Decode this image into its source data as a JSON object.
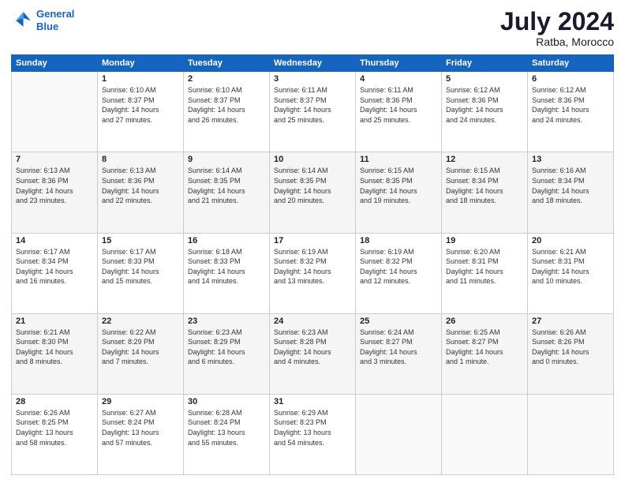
{
  "header": {
    "logo_line1": "General",
    "logo_line2": "Blue",
    "main_title": "July 2024",
    "subtitle": "Ratba, Morocco"
  },
  "days_of_week": [
    "Sunday",
    "Monday",
    "Tuesday",
    "Wednesday",
    "Thursday",
    "Friday",
    "Saturday"
  ],
  "weeks": [
    [
      {
        "day": "",
        "info": ""
      },
      {
        "day": "1",
        "info": "Sunrise: 6:10 AM\nSunset: 8:37 PM\nDaylight: 14 hours\nand 27 minutes."
      },
      {
        "day": "2",
        "info": "Sunrise: 6:10 AM\nSunset: 8:37 PM\nDaylight: 14 hours\nand 26 minutes."
      },
      {
        "day": "3",
        "info": "Sunrise: 6:11 AM\nSunset: 8:37 PM\nDaylight: 14 hours\nand 25 minutes."
      },
      {
        "day": "4",
        "info": "Sunrise: 6:11 AM\nSunset: 8:36 PM\nDaylight: 14 hours\nand 25 minutes."
      },
      {
        "day": "5",
        "info": "Sunrise: 6:12 AM\nSunset: 8:36 PM\nDaylight: 14 hours\nand 24 minutes."
      },
      {
        "day": "6",
        "info": "Sunrise: 6:12 AM\nSunset: 8:36 PM\nDaylight: 14 hours\nand 24 minutes."
      }
    ],
    [
      {
        "day": "7",
        "info": "Sunrise: 6:13 AM\nSunset: 8:36 PM\nDaylight: 14 hours\nand 23 minutes."
      },
      {
        "day": "8",
        "info": "Sunrise: 6:13 AM\nSunset: 8:36 PM\nDaylight: 14 hours\nand 22 minutes."
      },
      {
        "day": "9",
        "info": "Sunrise: 6:14 AM\nSunset: 8:35 PM\nDaylight: 14 hours\nand 21 minutes."
      },
      {
        "day": "10",
        "info": "Sunrise: 6:14 AM\nSunset: 8:35 PM\nDaylight: 14 hours\nand 20 minutes."
      },
      {
        "day": "11",
        "info": "Sunrise: 6:15 AM\nSunset: 8:35 PM\nDaylight: 14 hours\nand 19 minutes."
      },
      {
        "day": "12",
        "info": "Sunrise: 6:15 AM\nSunset: 8:34 PM\nDaylight: 14 hours\nand 18 minutes."
      },
      {
        "day": "13",
        "info": "Sunrise: 6:16 AM\nSunset: 8:34 PM\nDaylight: 14 hours\nand 18 minutes."
      }
    ],
    [
      {
        "day": "14",
        "info": "Sunrise: 6:17 AM\nSunset: 8:34 PM\nDaylight: 14 hours\nand 16 minutes."
      },
      {
        "day": "15",
        "info": "Sunrise: 6:17 AM\nSunset: 8:33 PM\nDaylight: 14 hours\nand 15 minutes."
      },
      {
        "day": "16",
        "info": "Sunrise: 6:18 AM\nSunset: 8:33 PM\nDaylight: 14 hours\nand 14 minutes."
      },
      {
        "day": "17",
        "info": "Sunrise: 6:19 AM\nSunset: 8:32 PM\nDaylight: 14 hours\nand 13 minutes."
      },
      {
        "day": "18",
        "info": "Sunrise: 6:19 AM\nSunset: 8:32 PM\nDaylight: 14 hours\nand 12 minutes."
      },
      {
        "day": "19",
        "info": "Sunrise: 6:20 AM\nSunset: 8:31 PM\nDaylight: 14 hours\nand 11 minutes."
      },
      {
        "day": "20",
        "info": "Sunrise: 6:21 AM\nSunset: 8:31 PM\nDaylight: 14 hours\nand 10 minutes."
      }
    ],
    [
      {
        "day": "21",
        "info": "Sunrise: 6:21 AM\nSunset: 8:30 PM\nDaylight: 14 hours\nand 8 minutes."
      },
      {
        "day": "22",
        "info": "Sunrise: 6:22 AM\nSunset: 8:29 PM\nDaylight: 14 hours\nand 7 minutes."
      },
      {
        "day": "23",
        "info": "Sunrise: 6:23 AM\nSunset: 8:29 PM\nDaylight: 14 hours\nand 6 minutes."
      },
      {
        "day": "24",
        "info": "Sunrise: 6:23 AM\nSunset: 8:28 PM\nDaylight: 14 hours\nand 4 minutes."
      },
      {
        "day": "25",
        "info": "Sunrise: 6:24 AM\nSunset: 8:27 PM\nDaylight: 14 hours\nand 3 minutes."
      },
      {
        "day": "26",
        "info": "Sunrise: 6:25 AM\nSunset: 8:27 PM\nDaylight: 14 hours\nand 1 minute."
      },
      {
        "day": "27",
        "info": "Sunrise: 6:26 AM\nSunset: 8:26 PM\nDaylight: 14 hours\nand 0 minutes."
      }
    ],
    [
      {
        "day": "28",
        "info": "Sunrise: 6:26 AM\nSunset: 8:25 PM\nDaylight: 13 hours\nand 58 minutes."
      },
      {
        "day": "29",
        "info": "Sunrise: 6:27 AM\nSunset: 8:24 PM\nDaylight: 13 hours\nand 57 minutes."
      },
      {
        "day": "30",
        "info": "Sunrise: 6:28 AM\nSunset: 8:24 PM\nDaylight: 13 hours\nand 55 minutes."
      },
      {
        "day": "31",
        "info": "Sunrise: 6:29 AM\nSunset: 8:23 PM\nDaylight: 13 hours\nand 54 minutes."
      },
      {
        "day": "",
        "info": ""
      },
      {
        "day": "",
        "info": ""
      },
      {
        "day": "",
        "info": ""
      }
    ]
  ]
}
